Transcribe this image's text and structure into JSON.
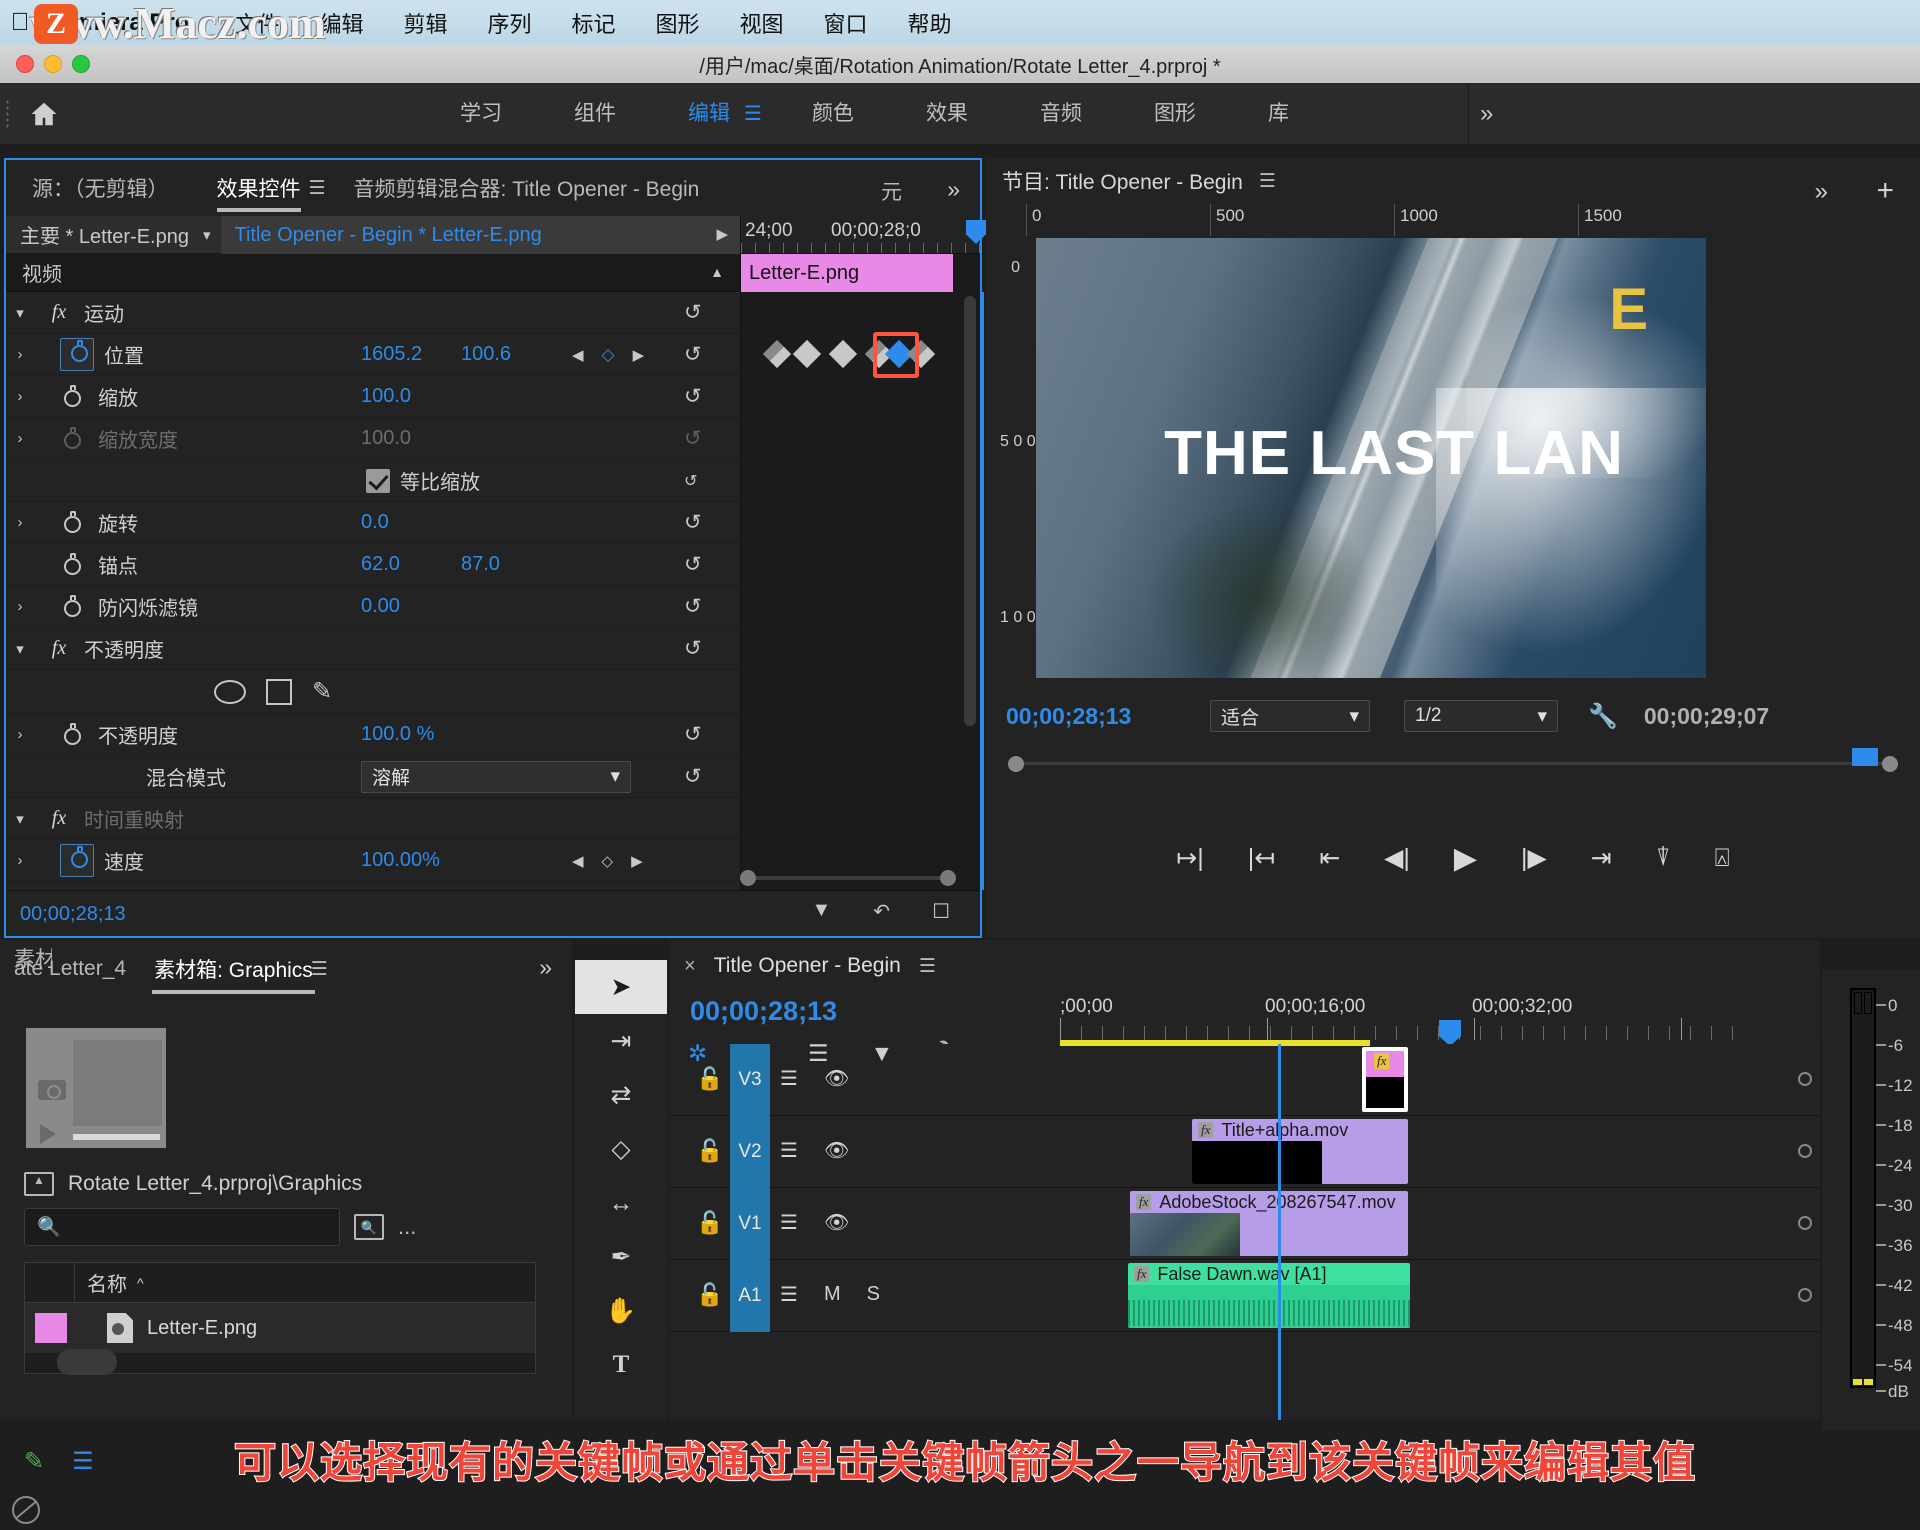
{
  "macmenu": {
    "app_name": "Premiera Pro",
    "items": [
      "文件",
      "编辑",
      "剪辑",
      "序列",
      "标记",
      "图形",
      "视图",
      "窗口",
      "帮助"
    ]
  },
  "watermark": {
    "text": "www.Macz.com",
    "logo": "Z"
  },
  "titlebar": {
    "path": "/用户/mac/桌面/Rotation Animation/Rotate Letter_4.prproj *"
  },
  "workspace": {
    "home_icon": "home-icon",
    "tabs": [
      "学习",
      "组件",
      "编辑",
      "颜色",
      "效果",
      "音频",
      "图形",
      "库"
    ],
    "active_tab": "编辑",
    "more": "»"
  },
  "effect_controls": {
    "tabs": [
      {
        "label": "源：（无剪辑）",
        "active": false
      },
      {
        "label": "效果控件",
        "active": true
      },
      {
        "label": "音频剪辑混合器: Title Opener - Begin",
        "active": false
      }
    ],
    "yuan_label": "元",
    "more": "»",
    "clip_bar": {
      "master": "主要 * Letter-E.png",
      "chevron": "chevron-down-icon",
      "sequence": "Title Opener - Begin * Letter-E.png",
      "arrow": "▶"
    },
    "video_section": "视频",
    "groups": [
      {
        "name": "运动",
        "fx": "fx"
      },
      {
        "name": "不透明度",
        "fx": "fx"
      },
      {
        "name": "时间重映射",
        "fx": "fx"
      }
    ],
    "properties": [
      {
        "label": "位置",
        "v1": "1605.2",
        "v2": "100.6",
        "stopwatch": "on",
        "has_kfnav": true,
        "dim": false
      },
      {
        "label": "缩放",
        "v1": "100.0",
        "v2": "",
        "stopwatch": "off",
        "has_kfnav": false,
        "dim": false
      },
      {
        "label": "缩放宽度",
        "v1": "100.0",
        "v2": "",
        "stopwatch": "dim",
        "has_kfnav": false,
        "dim": true
      },
      {
        "label": "旋转",
        "v1": "0.0",
        "v2": "",
        "stopwatch": "off",
        "has_kfnav": false,
        "dim": false
      },
      {
        "label": "锚点",
        "v1": "62.0",
        "v2": "87.0",
        "stopwatch": "off",
        "has_kfnav": false,
        "dim": false
      },
      {
        "label": "防闪烁滤镜",
        "v1": "0.00",
        "v2": "",
        "stopwatch": "off",
        "has_kfnav": false,
        "dim": false
      }
    ],
    "uniform_scale_label": "等比缩放",
    "uniform_scale_checked": true,
    "mask_tools": [
      "ellipse-mask-icon",
      "rectangle-mask-icon",
      "pen-mask-icon"
    ],
    "opacity_prop": {
      "label": "不透明度",
      "value": "100.0 %"
    },
    "blend_mode": {
      "label": "混合模式",
      "value": "溶解"
    },
    "speed_prop": {
      "label": "速度",
      "value": "100.00%"
    },
    "timeline": {
      "ruler_left": "24;00",
      "ruler_right": "00;00;28;0",
      "clip_name": "Letter-E.png",
      "keyframes_count": 6,
      "selected_keyframe_index": 4
    },
    "footer_timecode": "00;00;28;13"
  },
  "program_monitor": {
    "title": "节目: Title Opener - Begin",
    "menu": "hamburger-icon",
    "ruler_ticks": [
      "0",
      "500",
      "1000",
      "1500"
    ],
    "v_ruler": [
      "0",
      "5 0 0",
      "1 0 0"
    ],
    "overlay_title": "THE LAST LAN",
    "overlay_letter": "E",
    "timecode": "00;00;28;13",
    "fit_select": "适合",
    "quality_select": "1/2",
    "wrench": "wrench-icon",
    "duration": "00;00;29;07",
    "transport": [
      "mark-in-icon",
      "mark-out-icon",
      "go-to-in-icon",
      "step-back-icon",
      "play-icon",
      "step-forward-icon",
      "go-to-out-icon",
      "lift-icon",
      "extract-icon"
    ],
    "more": "»",
    "plus": "+"
  },
  "project_panel": {
    "tabs": [
      {
        "label": "ate Letter_4",
        "active": false
      },
      {
        "label": "素材箱: Graphics",
        "active": true
      },
      {
        "label": "素材",
        "active": false
      }
    ],
    "menu": "hamburger-icon",
    "more": "»",
    "path": "Rotate Letter_4.prproj\\Graphics",
    "search_placeholder": "",
    "find_icon": "find-icon",
    "overflow": "...",
    "columns": [
      "名称"
    ],
    "sort_indicator": "^",
    "rows": [
      {
        "name": "Letter-E.png",
        "color": "#e889e8",
        "icon": "image-file-icon"
      }
    ]
  },
  "toolbar": {
    "tools": [
      "selection-tool",
      "track-select-forward-tool",
      "ripple-edit-tool",
      "rate-stretch-tool",
      "slip-tool",
      "pen-tool",
      "hand-tool",
      "type-tool"
    ],
    "active_tool": "selection-tool"
  },
  "timeline_panel": {
    "close": "×",
    "title": "Title Opener - Begin",
    "menu": "hamburger-icon",
    "timecode": "00;00;28;13",
    "toggles": [
      "nest-sequence-icon",
      "snap-icon",
      "linked-selection-icon",
      "marker-icon",
      "wrench-icon"
    ],
    "ruler_labels": [
      ";00;00",
      "00;00;16;00",
      "00;00;32;00"
    ],
    "tracks": [
      {
        "name": "V3",
        "type": "video",
        "lock": "lock-icon",
        "controls": [
          "target-track-icon",
          "eye-icon"
        ],
        "clips": [
          {
            "name": "",
            "fx": "fx",
            "kind": "graphic"
          }
        ]
      },
      {
        "name": "V2",
        "type": "video",
        "lock": "lock-icon",
        "controls": [
          "target-track-icon",
          "eye-icon"
        ],
        "clips": [
          {
            "name": "Title+alpha.mov",
            "fx": "fx",
            "kind": "video"
          }
        ]
      },
      {
        "name": "V1",
        "type": "video",
        "lock": "lock-icon",
        "controls": [
          "target-track-icon",
          "eye-icon"
        ],
        "clips": [
          {
            "name": "AdobeStock_208267547.mov",
            "fx": "fx",
            "kind": "video"
          }
        ]
      },
      {
        "name": "A1",
        "type": "audio",
        "lock": "lock-icon",
        "controls": [
          "target-track-icon",
          "M",
          "S",
          "mic-icon"
        ],
        "clips": [
          {
            "name": "False Dawn.wav [A1]",
            "fx": "fx",
            "kind": "audio"
          }
        ]
      }
    ]
  },
  "audio_meter": {
    "labels": [
      "0",
      "-6",
      "-12",
      "-18",
      "-24",
      "-30",
      "-36",
      "-42",
      "-48",
      "-54",
      "dB"
    ]
  },
  "caption": {
    "text": "可以选择现有的关键帧或通过单击关键帧箭头之一导航到该关键帧来编辑其值"
  },
  "colors": {
    "accent_blue": "#2d8ceb",
    "clip_purple": "#b79ce8",
    "clip_pink": "#e889e8",
    "audio_green": "#2fcf92",
    "caption_red": "#f0463a",
    "highlight_orange": "#ff5540"
  }
}
